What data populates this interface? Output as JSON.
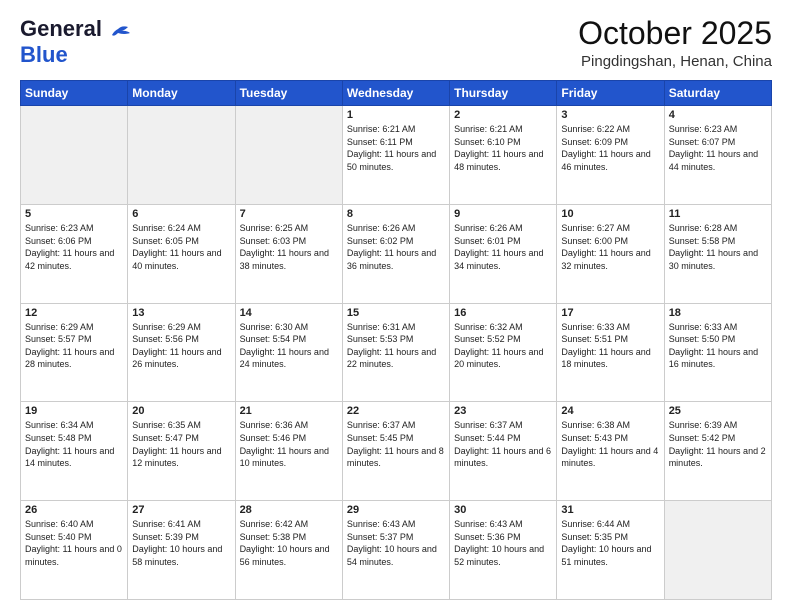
{
  "header": {
    "logo_general": "General",
    "logo_blue": "Blue",
    "month": "October 2025",
    "location": "Pingdingshan, Henan, China"
  },
  "weekdays": [
    "Sunday",
    "Monday",
    "Tuesday",
    "Wednesday",
    "Thursday",
    "Friday",
    "Saturday"
  ],
  "weeks": [
    [
      {
        "day": null
      },
      {
        "day": null
      },
      {
        "day": null
      },
      {
        "day": "1",
        "sunrise": "6:21 AM",
        "sunset": "6:11 PM",
        "daylight": "11 hours and 50 minutes."
      },
      {
        "day": "2",
        "sunrise": "6:21 AM",
        "sunset": "6:10 PM",
        "daylight": "11 hours and 48 minutes."
      },
      {
        "day": "3",
        "sunrise": "6:22 AM",
        "sunset": "6:09 PM",
        "daylight": "11 hours and 46 minutes."
      },
      {
        "day": "4",
        "sunrise": "6:23 AM",
        "sunset": "6:07 PM",
        "daylight": "11 hours and 44 minutes."
      }
    ],
    [
      {
        "day": "5",
        "sunrise": "6:23 AM",
        "sunset": "6:06 PM",
        "daylight": "11 hours and 42 minutes."
      },
      {
        "day": "6",
        "sunrise": "6:24 AM",
        "sunset": "6:05 PM",
        "daylight": "11 hours and 40 minutes."
      },
      {
        "day": "7",
        "sunrise": "6:25 AM",
        "sunset": "6:03 PM",
        "daylight": "11 hours and 38 minutes."
      },
      {
        "day": "8",
        "sunrise": "6:26 AM",
        "sunset": "6:02 PM",
        "daylight": "11 hours and 36 minutes."
      },
      {
        "day": "9",
        "sunrise": "6:26 AM",
        "sunset": "6:01 PM",
        "daylight": "11 hours and 34 minutes."
      },
      {
        "day": "10",
        "sunrise": "6:27 AM",
        "sunset": "6:00 PM",
        "daylight": "11 hours and 32 minutes."
      },
      {
        "day": "11",
        "sunrise": "6:28 AM",
        "sunset": "5:58 PM",
        "daylight": "11 hours and 30 minutes."
      }
    ],
    [
      {
        "day": "12",
        "sunrise": "6:29 AM",
        "sunset": "5:57 PM",
        "daylight": "11 hours and 28 minutes."
      },
      {
        "day": "13",
        "sunrise": "6:29 AM",
        "sunset": "5:56 PM",
        "daylight": "11 hours and 26 minutes."
      },
      {
        "day": "14",
        "sunrise": "6:30 AM",
        "sunset": "5:54 PM",
        "daylight": "11 hours and 24 minutes."
      },
      {
        "day": "15",
        "sunrise": "6:31 AM",
        "sunset": "5:53 PM",
        "daylight": "11 hours and 22 minutes."
      },
      {
        "day": "16",
        "sunrise": "6:32 AM",
        "sunset": "5:52 PM",
        "daylight": "11 hours and 20 minutes."
      },
      {
        "day": "17",
        "sunrise": "6:33 AM",
        "sunset": "5:51 PM",
        "daylight": "11 hours and 18 minutes."
      },
      {
        "day": "18",
        "sunrise": "6:33 AM",
        "sunset": "5:50 PM",
        "daylight": "11 hours and 16 minutes."
      }
    ],
    [
      {
        "day": "19",
        "sunrise": "6:34 AM",
        "sunset": "5:48 PM",
        "daylight": "11 hours and 14 minutes."
      },
      {
        "day": "20",
        "sunrise": "6:35 AM",
        "sunset": "5:47 PM",
        "daylight": "11 hours and 12 minutes."
      },
      {
        "day": "21",
        "sunrise": "6:36 AM",
        "sunset": "5:46 PM",
        "daylight": "11 hours and 10 minutes."
      },
      {
        "day": "22",
        "sunrise": "6:37 AM",
        "sunset": "5:45 PM",
        "daylight": "11 hours and 8 minutes."
      },
      {
        "day": "23",
        "sunrise": "6:37 AM",
        "sunset": "5:44 PM",
        "daylight": "11 hours and 6 minutes."
      },
      {
        "day": "24",
        "sunrise": "6:38 AM",
        "sunset": "5:43 PM",
        "daylight": "11 hours and 4 minutes."
      },
      {
        "day": "25",
        "sunrise": "6:39 AM",
        "sunset": "5:42 PM",
        "daylight": "11 hours and 2 minutes."
      }
    ],
    [
      {
        "day": "26",
        "sunrise": "6:40 AM",
        "sunset": "5:40 PM",
        "daylight": "11 hours and 0 minutes."
      },
      {
        "day": "27",
        "sunrise": "6:41 AM",
        "sunset": "5:39 PM",
        "daylight": "10 hours and 58 minutes."
      },
      {
        "day": "28",
        "sunrise": "6:42 AM",
        "sunset": "5:38 PM",
        "daylight": "10 hours and 56 minutes."
      },
      {
        "day": "29",
        "sunrise": "6:43 AM",
        "sunset": "5:37 PM",
        "daylight": "10 hours and 54 minutes."
      },
      {
        "day": "30",
        "sunrise": "6:43 AM",
        "sunset": "5:36 PM",
        "daylight": "10 hours and 52 minutes."
      },
      {
        "day": "31",
        "sunrise": "6:44 AM",
        "sunset": "5:35 PM",
        "daylight": "10 hours and 51 minutes."
      },
      {
        "day": null
      }
    ]
  ]
}
